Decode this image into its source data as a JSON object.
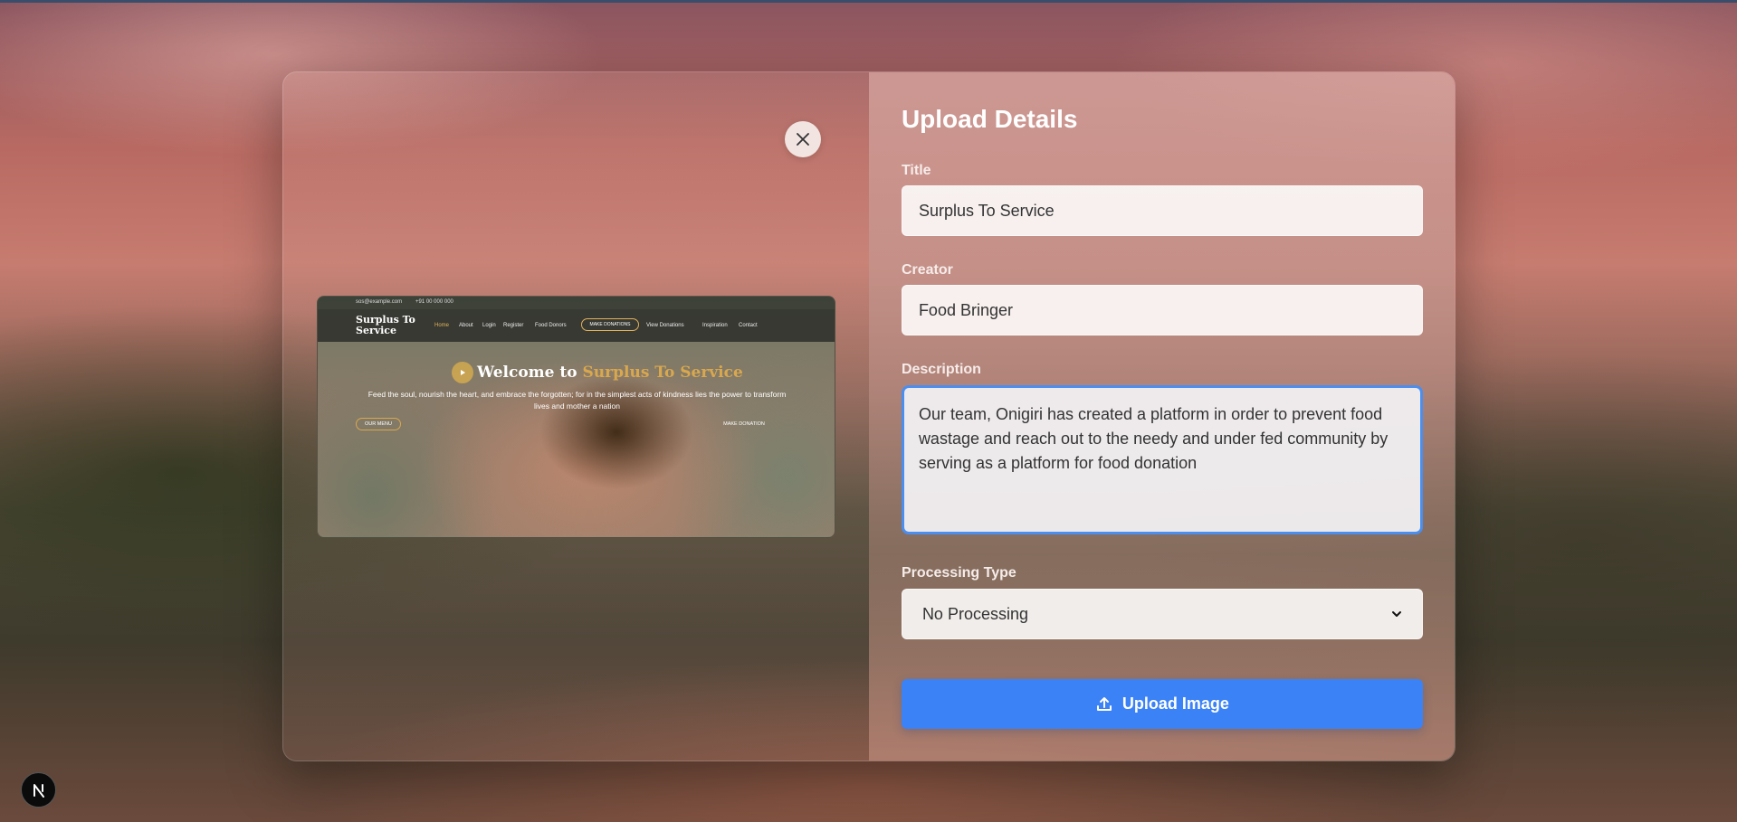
{
  "modal": {
    "heading": "Upload Details",
    "title_label": "Title",
    "title_value": "Surplus To Service",
    "creator_label": "Creator",
    "creator_value": "Food Bringer",
    "description_label": "Description",
    "description_value": "Our team, Onigiri has created a platform in order to prevent food wastage and reach out to the needy and under fed community by serving as a platform for food donation",
    "processing_label": "Processing Type",
    "processing_value": "No Processing",
    "upload_button": "Upload Image",
    "close_icon": "close-icon",
    "upload_icon": "upload-icon"
  },
  "preview": {
    "contact_email": "sos@example.com",
    "contact_phone": "+91 00 000 000",
    "logo": "Surplus To Service",
    "nav": [
      "Home",
      "About",
      "Login",
      "Register",
      "Food Donors",
      "MAKE DONATIONS",
      "View Donations",
      "Inspiration",
      "Contact"
    ],
    "hero_title_prefix": "Welcome to ",
    "hero_title_accent": "Surplus To Service",
    "hero_subtitle": "Feed the soul, nourish the heart, and embrace the forgotten; for in the simplest acts of kindness lies the power to transform lives and mother a nation",
    "btn_menu": "OUR MENU",
    "btn_donation": "MAKE DONATION"
  },
  "dev_badge": "N",
  "colors": {
    "accent": "#3b82f6",
    "focus_ring": "#4a8ef0",
    "preview_gold": "#d9a84e"
  }
}
